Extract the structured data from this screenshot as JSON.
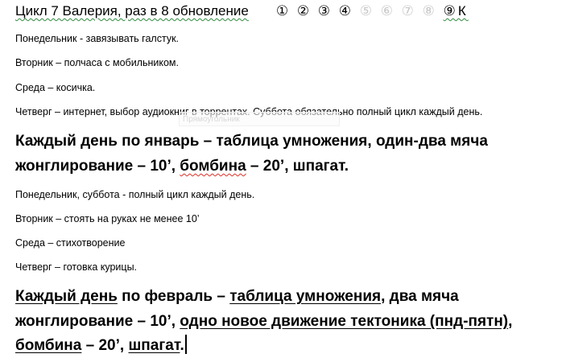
{
  "title": {
    "text": "Цикл 7 Валерия, раз в 8 обновление",
    "marks_dark": "① ② ③ ④",
    "marks_light": "⑤ ⑥ ⑦ ⑧",
    "marks_last": "⑨К"
  },
  "ghost_tooltip": "Прямоугольник",
  "week1": [
    "Понедельник -  завязывать галстук.",
    "Вторник – полчаса с мобильником.",
    "Среда – косичка.",
    "Четверг – интернет, выбор аудиокниг в торрентах. Суббота обязательно полный цикл каждый день."
  ],
  "january": {
    "line1": "Каждый день по январь – таблица умножения, один-два мяча",
    "line2_a": "жонглирование – 10’,  ",
    "line2_b": "бомбина",
    "line2_c": " – 20’, шпагат."
  },
  "week2": [
    "Понедельник, суббота -  полный цикл каждый день.",
    "Вторник – стоять на руках не менее 10’",
    "Среда – стихотворение",
    "Четверг – готовка курицы."
  ],
  "february": {
    "l1_a": "Каждый день",
    "l1_b": " по февраль – ",
    "l1_c": "таблица умножения",
    "l1_d": ", два мяча",
    "l2_a": "жонглирование – 10’, ",
    "l2_b": "одно новое движение тектоника (пнд-пятн)",
    "l2_c": ",",
    "l3_a": "бомбина",
    "l3_b": " – 20’, ",
    "l3_c": "шпагат",
    "l3_d": "."
  }
}
